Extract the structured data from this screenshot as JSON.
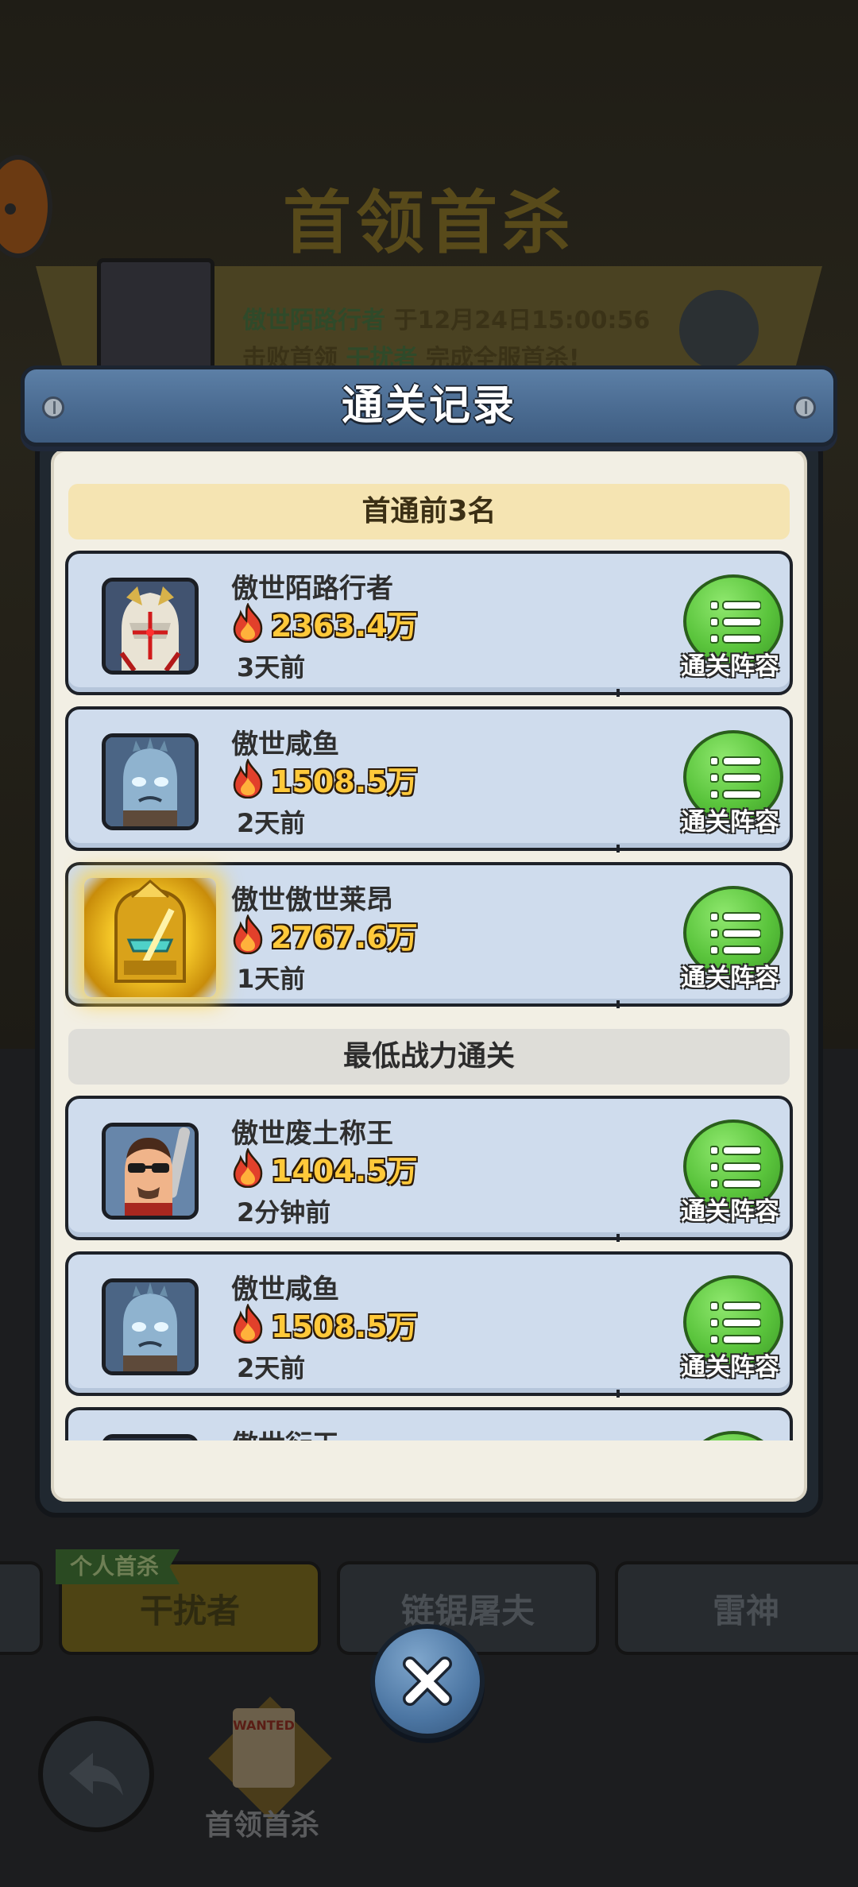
{
  "background": {
    "title": "首领首杀",
    "banner": {
      "player": "傲世陌路行者",
      "line1_middle": "于12月24日15:00:56",
      "line2_prefix": "击败首领",
      "boss": "干扰者",
      "line2_suffix": "完成全服首杀!"
    },
    "tabs": [
      {
        "label": "干扰者",
        "active": true
      },
      {
        "label": "链锯屠夫",
        "active": false
      },
      {
        "label": "雷神",
        "active": false
      }
    ],
    "tab_badge": "个人首杀",
    "bottom_nav": {
      "wanted_label": "首领首杀",
      "wanted_sign": "WANTED"
    }
  },
  "modal": {
    "title": "通关记录",
    "section_first_clear": "首通前3名",
    "section_lowest_power": "最低战力通关",
    "lineup_label": "通关阵容",
    "first_clear_records": [
      {
        "name": "傲世陌路行者",
        "power": "2363.4万",
        "time": "3天前",
        "portrait": "white-mask-hero"
      },
      {
        "name": "傲世咸鱼",
        "power": "1508.5万",
        "time": "2天前",
        "portrait": "blue-alien"
      },
      {
        "name": "傲世傲世莱昂",
        "power": "2767.6万",
        "time": "1天前",
        "portrait": "gold-mecha"
      }
    ],
    "lowest_power_records": [
      {
        "name": "傲世废土称王",
        "power": "1404.5万",
        "time": "2分钟前",
        "portrait": "sunglasses-man"
      },
      {
        "name": "傲世咸鱼",
        "power": "1508.5万",
        "time": "2天前",
        "portrait": "blue-alien"
      },
      {
        "name": "傲世衍天",
        "power": "",
        "time": "",
        "portrait": "partial"
      }
    ]
  },
  "colors": {
    "header_blue": "#4a6b91",
    "card_blue": "#cfdced",
    "power_gold": "#ffc93a",
    "button_green": "#5ac43c"
  },
  "icons": {
    "power": "fire-icon",
    "lineup": "list-icon",
    "close": "close-x-icon",
    "back": "back-arrow-icon"
  }
}
